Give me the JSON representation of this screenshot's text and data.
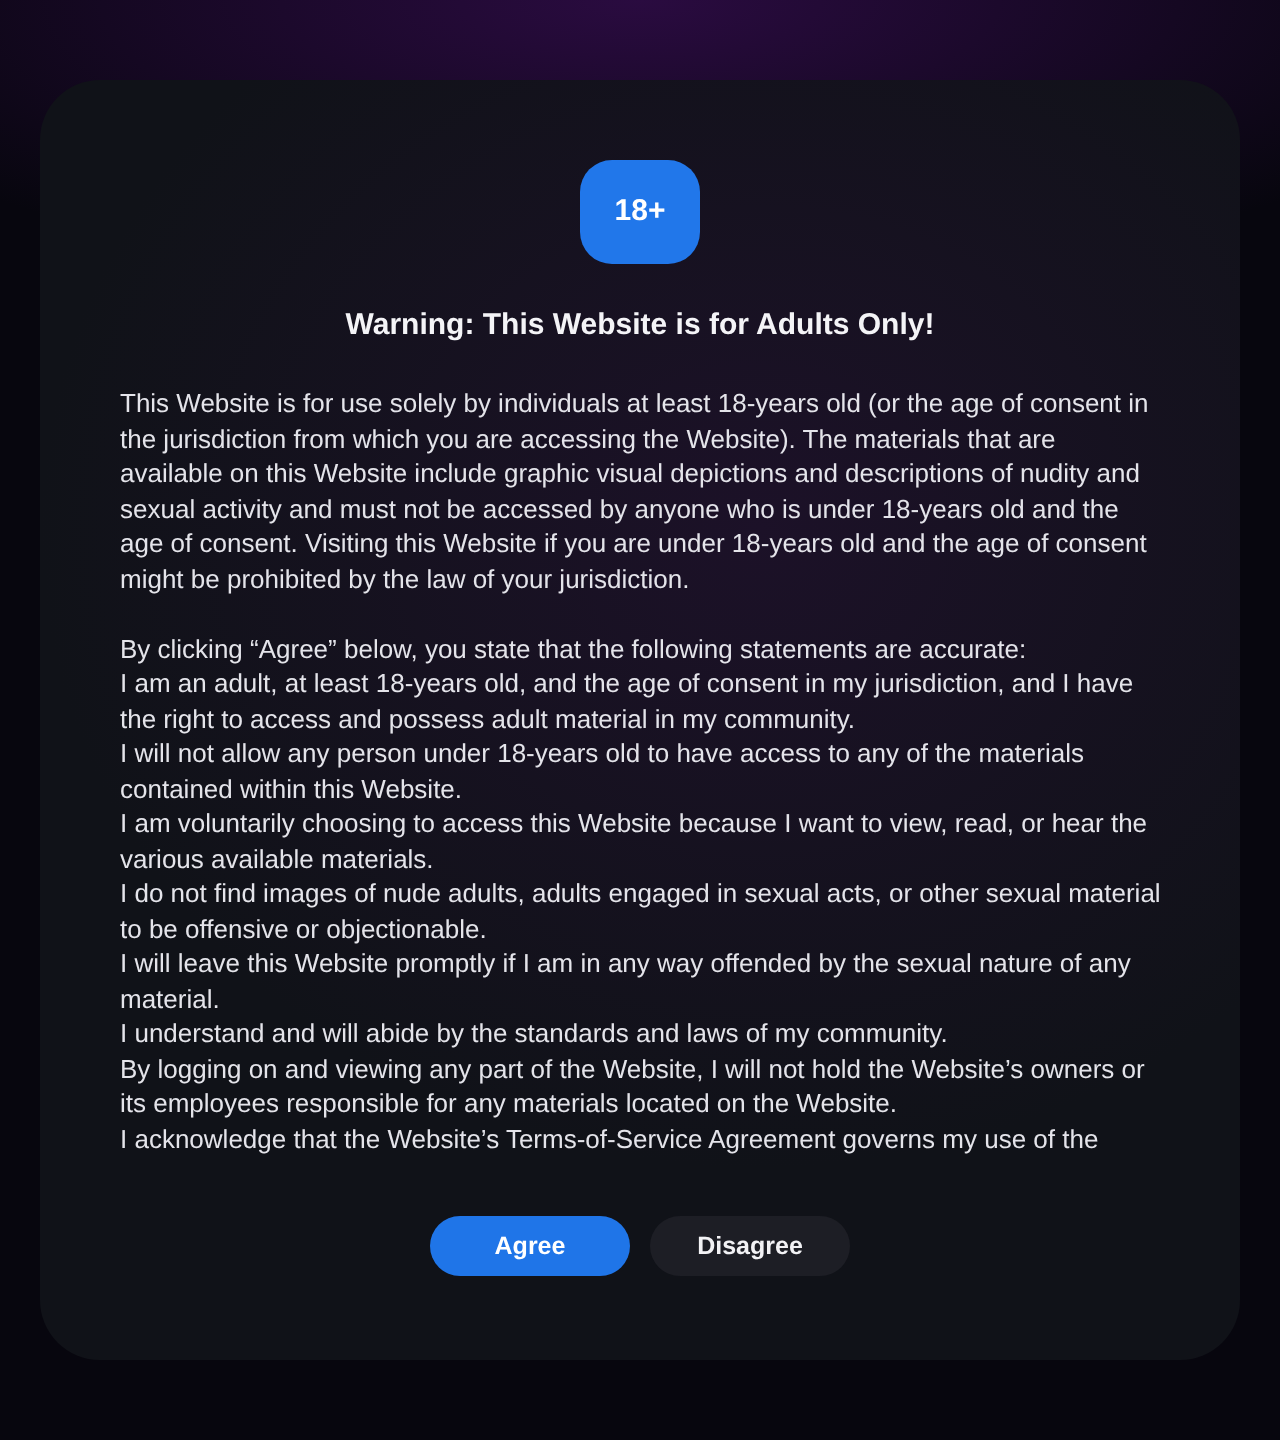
{
  "badge": {
    "text": "18+"
  },
  "title": "Warning: This Website is for Adults Only!",
  "intro": "This Website is for use solely by individuals at least 18-years old (or the age of consent in the jurisdiction from which you are accessing the Website). The materials that are available on this Website include graphic visual depictions and descriptions of nudity and sexual activity and must not be accessed by anyone who is under 18-years old and the age of consent. Visiting this Website if you are under 18-years old and the age of consent might be prohibited by the law of your jurisdiction.",
  "consent_lead": "By clicking “Agree” below, you state that the following statements are accurate:",
  "statements": [
    "I am an adult, at least 18-years old, and the age of consent in my jurisdiction, and I have the right to access and possess adult material in my community.",
    "I will not allow any person under 18-years old to have access to any of the materials contained within this Website.",
    "I am voluntarily choosing to access this Website because I want to view, read, or hear the various available materials.",
    "I do not find images of nude adults, adults engaged in sexual acts, or other sexual material to be offensive or objectionable.",
    "I will leave this Website promptly if I am in any way offended by the sexual nature of any material.",
    "I understand and will abide by the standards and laws of my community.",
    "By logging on and viewing any part of the Website, I will not hold the Website’s owners or its employees responsible for any materials located on the Website.",
    "I acknowledge that the Website’s Terms-of-Service Agreement governs my use of the"
  ],
  "buttons": [
    {
      "label": "Agree",
      "kind": "primary"
    },
    {
      "label": "Disagree",
      "kind": "secondary"
    }
  ]
}
